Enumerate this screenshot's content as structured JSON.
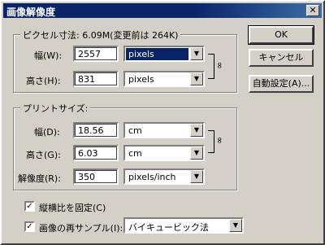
{
  "window": {
    "title": "画像解像度",
    "close_glyph": "✕"
  },
  "pixel_size": {
    "legend": "ピクセル寸法: 6.09M(変更前は 264K)",
    "width": {
      "label": "幅(W):",
      "value": "2557",
      "unit": "pixels"
    },
    "height": {
      "label": "高さ(H):",
      "value": "831",
      "unit": "pixels"
    }
  },
  "print_size": {
    "legend": "プリントサイズ:",
    "width": {
      "label": "幅(D):",
      "value": "18.56",
      "unit": "cm"
    },
    "height": {
      "label": "高さ(G):",
      "value": "6.03",
      "unit": "cm"
    },
    "resolution": {
      "label": "解像度(R):",
      "value": "350",
      "unit": "pixels/inch"
    }
  },
  "options": {
    "constrain": {
      "label": "縦横比を固定(C)",
      "checked": true
    },
    "resample": {
      "label": "画像の再サンプル(I):",
      "checked": true,
      "method": "バイキュービック法"
    }
  },
  "buttons": {
    "ok": "OK",
    "cancel": "キャンセル",
    "auto": "自動設定(A)..."
  },
  "icons": {
    "dropdown": "▼",
    "link": "chain-link-icon",
    "check": "✓"
  }
}
